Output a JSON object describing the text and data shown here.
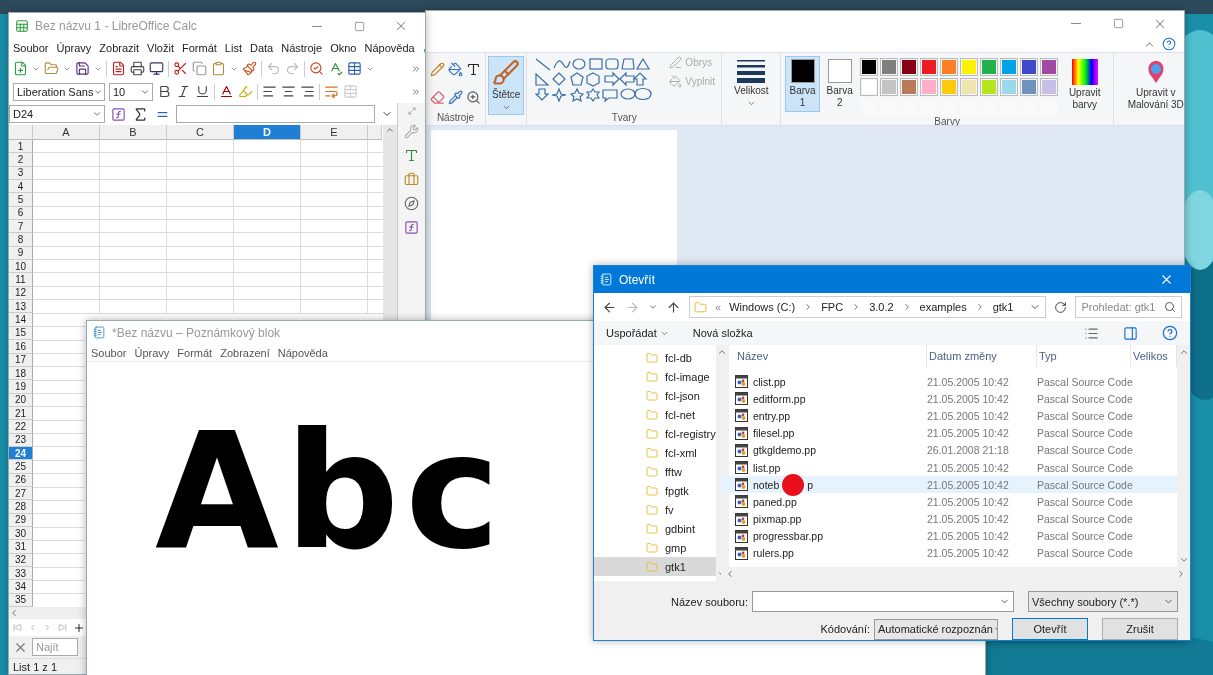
{
  "paint": {
    "tools_label": "Nástroje",
    "brushes_label": "Štětce",
    "shapes_label": "Tvary",
    "outline": "Obrys",
    "fill": "Vyplnit",
    "size_label": "Velikost",
    "color_slots": [
      {
        "label": "Barva",
        "number": "1",
        "color": "#000000",
        "selected": true
      },
      {
        "label": "Barva",
        "number": "2",
        "color": "#ffffff",
        "selected": false
      }
    ],
    "palette": [
      {
        "color": "#000000"
      },
      {
        "color": "#7f7f7f"
      },
      {
        "color": "#880015"
      },
      {
        "color": "#ed1c24"
      },
      {
        "color": "#ff7f27"
      },
      {
        "color": "#fff200"
      },
      {
        "color": "#22b14c"
      },
      {
        "color": "#00a2e8"
      },
      {
        "color": "#3f48cc"
      },
      {
        "color": "#a349a4"
      },
      {
        "color": "#ffffff"
      },
      {
        "color": "#c3c3c3"
      },
      {
        "color": "#b97a57"
      },
      {
        "color": "#ffaec9"
      },
      {
        "color": "#ffc90e"
      },
      {
        "color": "#efe4b0"
      },
      {
        "color": "#b5e61d"
      },
      {
        "color": "#99d9ea"
      },
      {
        "color": "#7092be"
      },
      {
        "color": "#c8bfe7"
      }
    ],
    "edit_colors": "Upravit barvy",
    "paint3d": "Upravit v Malování 3D",
    "colors_label": "Barvy"
  },
  "calc": {
    "title": "Bez názvu 1 - LibreOffice Calc",
    "menu": [
      "Soubor",
      "Úpravy",
      "Zobrazit",
      "Vložit",
      "Formát",
      "List",
      "Data",
      "Nástroje",
      "Okno",
      "Nápověda"
    ],
    "font_name": "Liberation Sans",
    "font_size": "10",
    "name_box": "D24",
    "columns": [
      {
        "label": "A",
        "selected": false
      },
      {
        "label": "B",
        "selected": false
      },
      {
        "label": "C",
        "selected": false
      },
      {
        "label": "D",
        "selected": true
      },
      {
        "label": "E",
        "selected": false
      }
    ],
    "rows": [
      {
        "label": "1",
        "selected": false
      },
      {
        "label": "2",
        "selected": false
      },
      {
        "label": "3",
        "selected": false
      },
      {
        "label": "4",
        "selected": false
      },
      {
        "label": "5",
        "selected": false
      },
      {
        "label": "6",
        "selected": false
      },
      {
        "label": "7",
        "selected": false
      },
      {
        "label": "8",
        "selected": false
      },
      {
        "label": "9",
        "selected": false
      },
      {
        "label": "10",
        "selected": false
      },
      {
        "label": "11",
        "selected": false
      },
      {
        "label": "12",
        "selected": false
      },
      {
        "label": "13",
        "selected": false
      },
      {
        "label": "14",
        "selected": false
      },
      {
        "label": "15",
        "selected": false
      },
      {
        "label": "16",
        "selected": false
      },
      {
        "label": "17",
        "selected": false
      },
      {
        "label": "18",
        "selected": false
      },
      {
        "label": "19",
        "selected": false
      },
      {
        "label": "20",
        "selected": false
      },
      {
        "label": "21",
        "selected": false
      },
      {
        "label": "22",
        "selected": false
      },
      {
        "label": "23",
        "selected": false
      },
      {
        "label": "24",
        "selected": true
      },
      {
        "label": "25",
        "selected": false
      },
      {
        "label": "26",
        "selected": false
      },
      {
        "label": "27",
        "selected": false
      },
      {
        "label": "28",
        "selected": false
      },
      {
        "label": "29",
        "selected": false
      },
      {
        "label": "30",
        "selected": false
      },
      {
        "label": "31",
        "selected": false
      },
      {
        "label": "32",
        "selected": false
      },
      {
        "label": "33",
        "selected": false
      },
      {
        "label": "34",
        "selected": false
      },
      {
        "label": "35",
        "selected": false
      }
    ],
    "find_placeholder": "Najít",
    "status": "List 1 z 1"
  },
  "notepad": {
    "title": "*Bez názvu – Poznámkový blok",
    "menu": [
      "Soubor",
      "Úpravy",
      "Formát",
      "Zobrazení",
      "Nápověda"
    ],
    "text": "Abc"
  },
  "dialog": {
    "title": "Otevřít",
    "path_overflow": "«",
    "path": [
      "Windows (C:)",
      "FPC",
      "3.0.2",
      "examples",
      "gtk1"
    ],
    "search_placeholder": "Prohledat: gtk1",
    "organize": "Uspořádat",
    "new_folder": "Nová složka",
    "folders": [
      {
        "name": "fcl-db",
        "selected": false
      },
      {
        "name": "fcl-image",
        "selected": false
      },
      {
        "name": "fcl-json",
        "selected": false
      },
      {
        "name": "fcl-net",
        "selected": false
      },
      {
        "name": "fcl-registry",
        "selected": false
      },
      {
        "name": "fcl-xml",
        "selected": false
      },
      {
        "name": "fftw",
        "selected": false
      },
      {
        "name": "fpgtk",
        "selected": false
      },
      {
        "name": "fv",
        "selected": false
      },
      {
        "name": "gdbint",
        "selected": false
      },
      {
        "name": "gmp",
        "selected": false
      },
      {
        "name": "gtk1",
        "selected": true
      }
    ],
    "columns": [
      "Název",
      "Datum změny",
      "Typ",
      "Velikos"
    ],
    "files": [
      {
        "name": "clist.pp",
        "date": "21.05.2005 10:42",
        "type": "Pascal Source Code",
        "hovered": false
      },
      {
        "name": "editform.pp",
        "date": "21.05.2005 10:42",
        "type": "Pascal Source Code",
        "hovered": false
      },
      {
        "name": "entry.pp",
        "date": "21.05.2005 10:42",
        "type": "Pascal Source Code",
        "hovered": false
      },
      {
        "name": "filesel.pp",
        "date": "21.05.2005 10:42",
        "type": "Pascal Source Code",
        "hovered": false
      },
      {
        "name": "gtkgldemo.pp",
        "date": "26.01.2008 21:18",
        "type": "Pascal Source Code",
        "hovered": false
      },
      {
        "name": "list.pp",
        "date": "21.05.2005 10:42",
        "type": "Pascal Source Code",
        "hovered": false
      },
      {
        "name": "noteb",
        "name_after_cursor": "p",
        "cursor": true,
        "date": "21.05.2005 10:42",
        "type": "Pascal Source Code",
        "hovered": true
      },
      {
        "name": "paned.pp",
        "date": "21.05.2005 10:42",
        "type": "Pascal Source Code",
        "hovered": false
      },
      {
        "name": "pixmap.pp",
        "date": "21.05.2005 10:42",
        "type": "Pascal Source Code",
        "hovered": false
      },
      {
        "name": "progressbar.pp",
        "date": "21.05.2005 10:42",
        "type": "Pascal Source Code",
        "hovered": false
      },
      {
        "name": "rulers.pp",
        "date": "21.05.2005 10:42",
        "type": "Pascal Source Code",
        "hovered": false
      }
    ],
    "filename_label": "Název souboru:",
    "filter": "Všechny soubory  (*.*)",
    "encoding_label": "Kódování:",
    "encoding": "Automatické rozpoznán",
    "buttons": [
      {
        "label": "Otevřít",
        "kind": "primary"
      },
      {
        "label": "Zrušit",
        "kind": "normal"
      }
    ]
  }
}
